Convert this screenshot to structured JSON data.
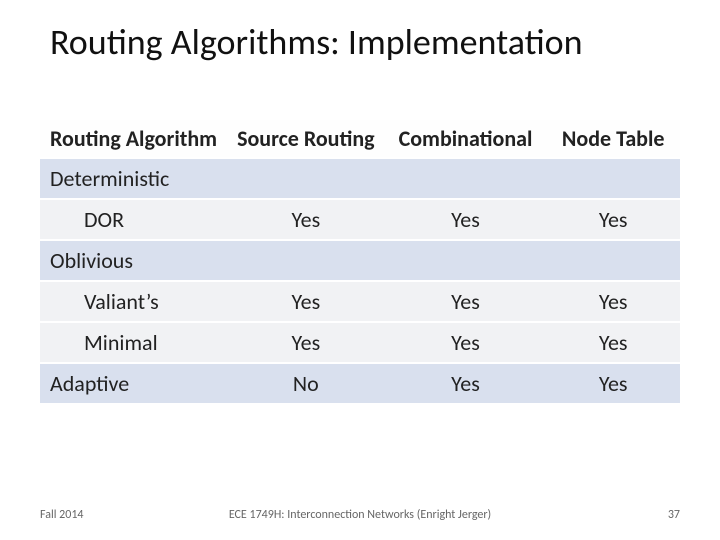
{
  "title": "Routing Algorithms: Implementation",
  "headers": {
    "algo": "Routing Algorithm",
    "source": "Source Routing",
    "combo": "Combinational",
    "node": "Node Table"
  },
  "rows": {
    "deterministic": {
      "label": "Deterministic"
    },
    "dor": {
      "label": "DOR",
      "source": "Yes",
      "combo": "Yes",
      "node": "Yes"
    },
    "oblivious": {
      "label": "Oblivious"
    },
    "valiant": {
      "label": "Valiant’s",
      "source": "Yes",
      "combo": "Yes",
      "node": "Yes"
    },
    "minimal": {
      "label": "Minimal",
      "source": "Yes",
      "combo": "Yes",
      "node": "Yes"
    },
    "adaptive": {
      "label": "Adaptive",
      "source": "No",
      "combo": "Yes",
      "node": "Yes"
    }
  },
  "footer": {
    "left": "Fall 2014",
    "center": "ECE 1749H: Interconnection Networks (Enright Jerger)",
    "right": "37"
  },
  "chart_data": {
    "type": "table",
    "title": "Routing Algorithms: Implementation",
    "columns": [
      "Routing Algorithm",
      "Source Routing",
      "Combinational",
      "Node Table"
    ],
    "rows": [
      [
        "Deterministic",
        "",
        "",
        ""
      ],
      [
        "DOR",
        "Yes",
        "Yes",
        "Yes"
      ],
      [
        "Oblivious",
        "",
        "",
        ""
      ],
      [
        "Valiant’s",
        "Yes",
        "Yes",
        "Yes"
      ],
      [
        "Minimal",
        "Yes",
        "Yes",
        "Yes"
      ],
      [
        "Adaptive",
        "No",
        "Yes",
        "Yes"
      ]
    ]
  }
}
